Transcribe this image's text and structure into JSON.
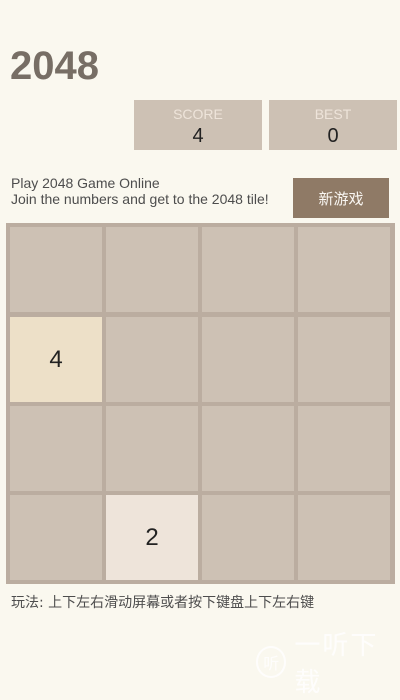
{
  "header": {
    "title": "2048"
  },
  "scores": {
    "score_label": "SCORE",
    "score_value": "4",
    "best_label": "BEST",
    "best_value": "0"
  },
  "intro": {
    "line1": "Play 2048 Game Online",
    "line2": "Join the numbers and get to the 2048 tile!"
  },
  "new_game_label": "新游戏",
  "board": {
    "rows": [
      [
        "",
        "",
        "",
        ""
      ],
      [
        "4",
        "",
        "",
        ""
      ],
      [
        "",
        "",
        "",
        ""
      ],
      [
        "",
        "2",
        "",
        ""
      ]
    ]
  },
  "howto": "玩法: 上下左右滑动屏幕或者按下键盘上下左右键",
  "watermark": {
    "logo": "听",
    "text": "一听下载"
  }
}
